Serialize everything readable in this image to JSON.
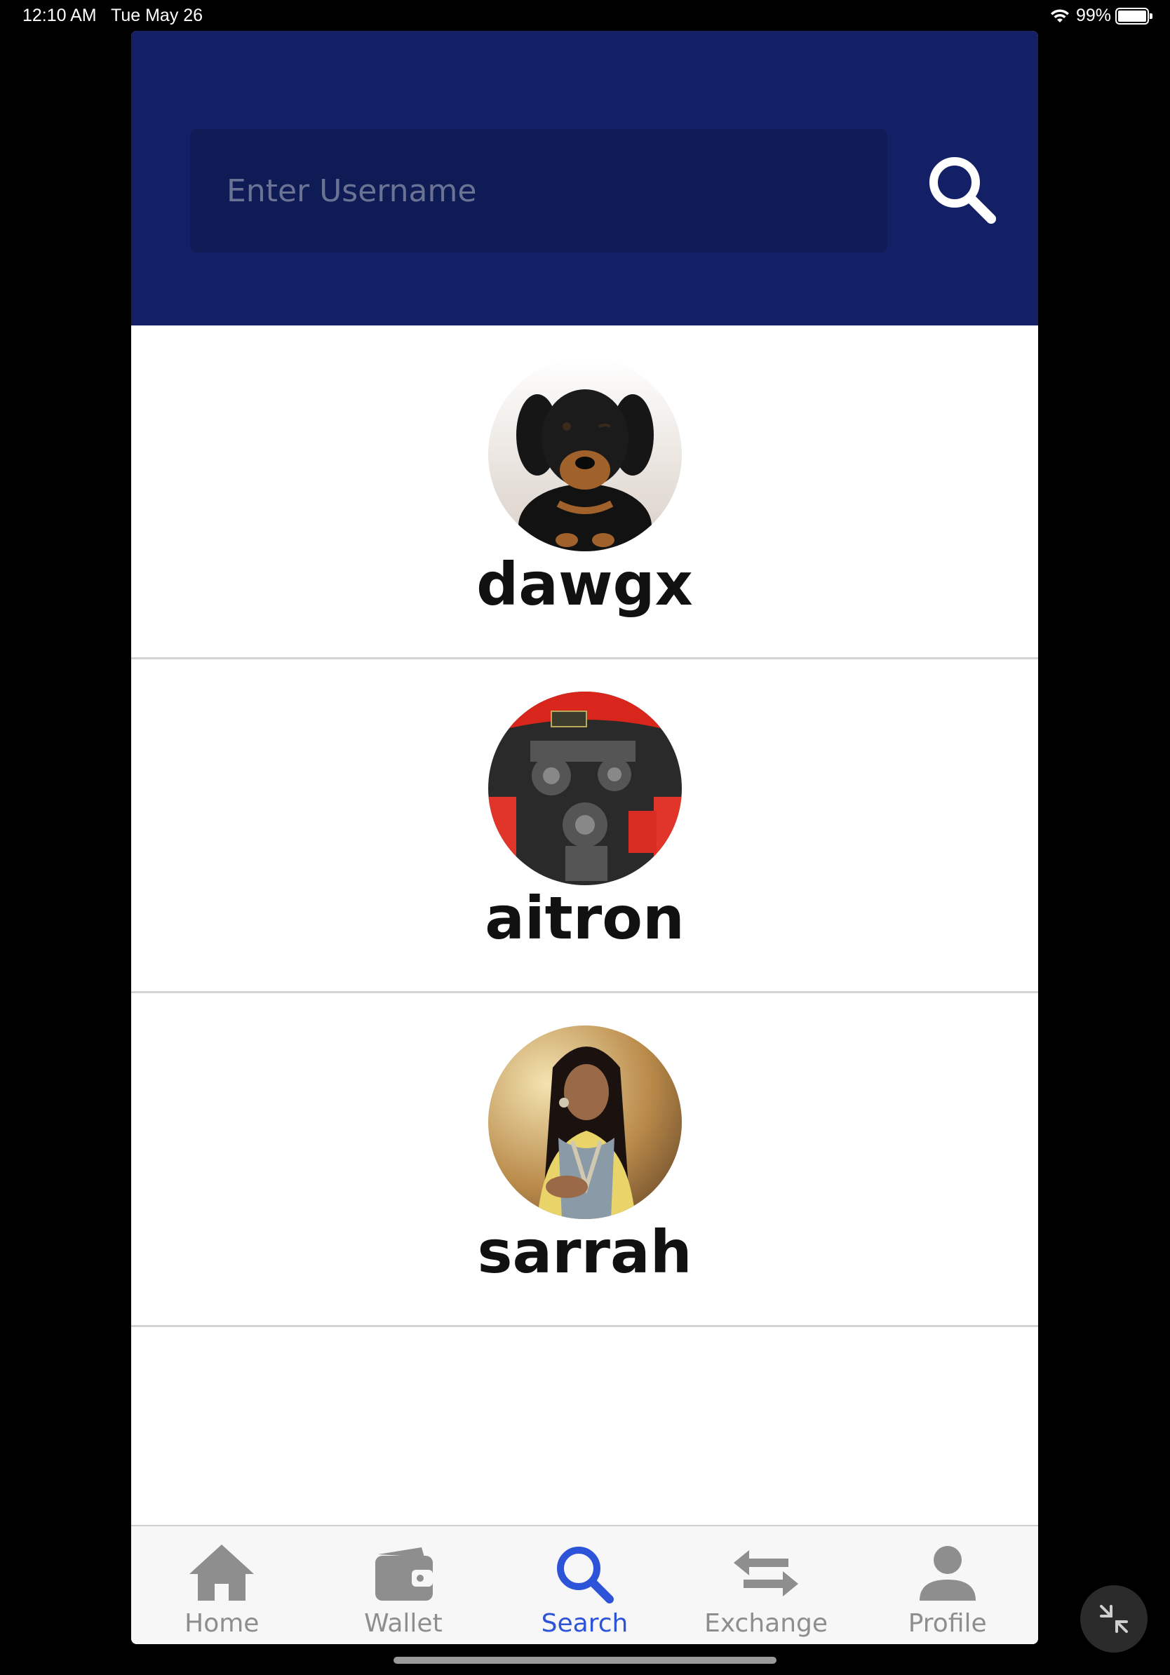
{
  "status_bar": {
    "time": "12:10 AM",
    "date": "Tue May 26",
    "battery": "99%"
  },
  "search": {
    "placeholder": "Enter Username",
    "button_icon": "search-icon"
  },
  "results": [
    {
      "username": "dawgx",
      "avatar": "puppy-photo"
    },
    {
      "username": "aitron",
      "avatar": "car-engine-photo"
    },
    {
      "username": "sarrah",
      "avatar": "woman-portrait-photo"
    }
  ],
  "tabs": [
    {
      "label": "Home",
      "icon": "home-icon",
      "active": false
    },
    {
      "label": "Wallet",
      "icon": "wallet-icon",
      "active": false
    },
    {
      "label": "Search",
      "icon": "search-icon",
      "active": true
    },
    {
      "label": "Exchange",
      "icon": "exchange-icon",
      "active": false
    },
    {
      "label": "Profile",
      "icon": "profile-icon",
      "active": false
    }
  ],
  "colors": {
    "header_bg": "#132066",
    "active_tab": "#2c53d8",
    "inactive_tab": "#8e8e8e"
  }
}
